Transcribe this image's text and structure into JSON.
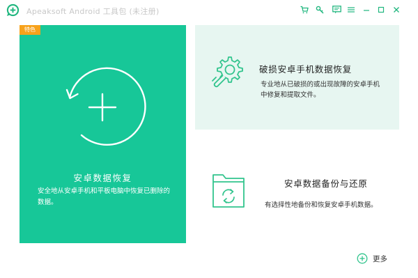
{
  "window": {
    "title": "Apeaksoft Android 工具包 (未注册)"
  },
  "toolbar": {
    "icons": [
      "cart-icon",
      "key-icon",
      "feedback-icon",
      "menu-icon",
      "minimize-icon",
      "maximize-icon",
      "close-icon"
    ]
  },
  "colors": {
    "accent": "#17c798",
    "badge": "#f7a21b",
    "card_light": "#e7f6f1",
    "icon_accent": "#31c48d"
  },
  "main_card": {
    "badge": "特色",
    "title": "安卓数据恢复",
    "description": "安全地从安卓手机和平板电脑中恢复已删除的数据。"
  },
  "broken_card": {
    "title": "破损安卓手机数据恢复",
    "description": "专业地从已破损的或出现故障的安卓手机中修复和提取文件。"
  },
  "backup_card": {
    "title": "安卓数据备份与还原",
    "description": "有选择性地备份和恢复安卓手机数据。"
  },
  "more": {
    "label": "更多"
  }
}
